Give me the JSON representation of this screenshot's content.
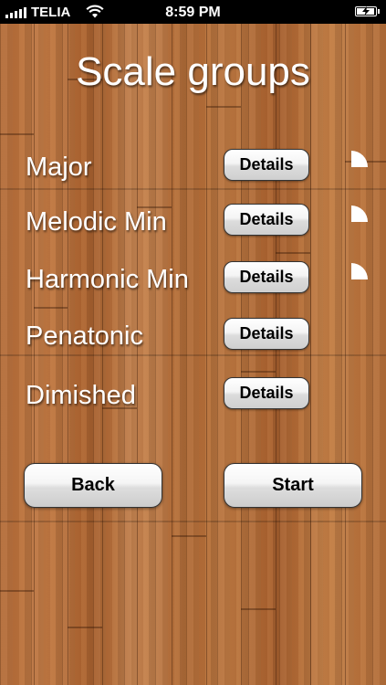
{
  "status_bar": {
    "carrier": "TELIA",
    "time": "8:59 PM",
    "signal_icon": "signal-bars-icon",
    "wifi_icon": "wifi-icon",
    "battery_icon": "battery-charging-icon"
  },
  "page": {
    "title": "Scale groups"
  },
  "scale_groups": [
    {
      "label": "Major",
      "details_label": "Details",
      "progress": 0.25
    },
    {
      "label": "Melodic Min",
      "details_label": "Details",
      "progress": 0.25
    },
    {
      "label": "Harmonic Min",
      "details_label": "Details",
      "progress": 0.25
    },
    {
      "label": "Penatonic",
      "details_label": "Details",
      "progress": 0
    },
    {
      "label": "Dimished",
      "details_label": "Details",
      "progress": 0
    }
  ],
  "footer": {
    "back_label": "Back",
    "start_label": "Start"
  },
  "colors": {
    "text": "#ffffff",
    "button_text": "#000000",
    "status_bar_bg": "#000000"
  }
}
